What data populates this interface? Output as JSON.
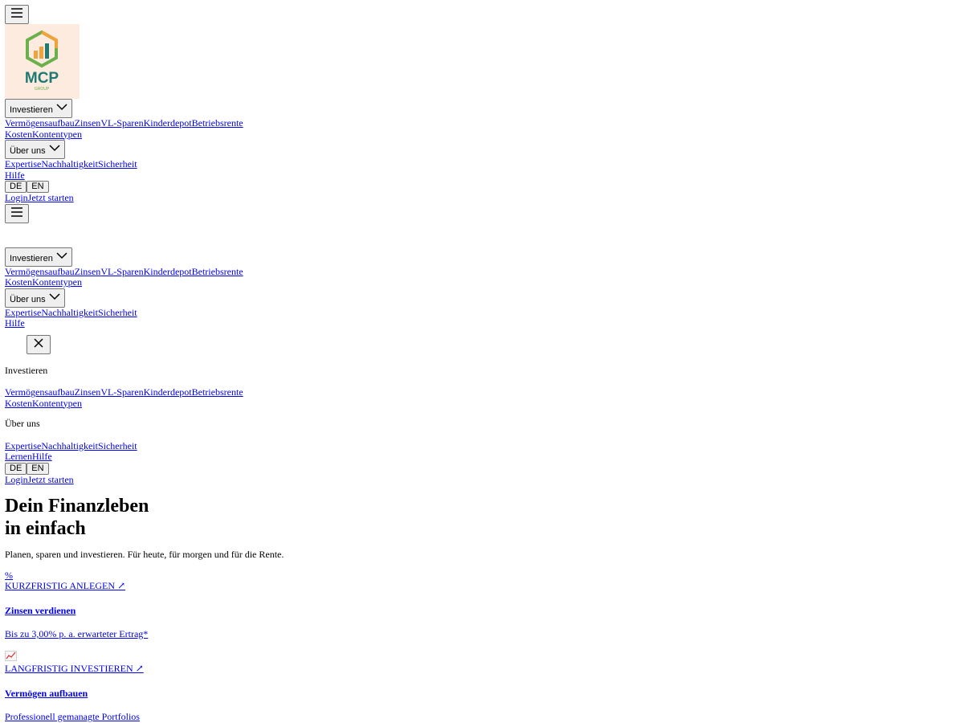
{
  "header": {
    "invest_label": "Investieren",
    "invest_links": [
      "Vermögensaufbau",
      "Zinsen",
      "VL-Sparen",
      "Kinderdepot",
      "Betriebsrente"
    ],
    "invest_links_2": [
      "Kosten",
      "Kontentypen"
    ],
    "about_label": "Über uns",
    "about_links": [
      "Expertise",
      "Nachhaltigkeit",
      "Sicherheit"
    ],
    "help_label": "Hilfe",
    "lang_de": "DE",
    "lang_en": "EN",
    "login_label": "Login",
    "start_label": "Jetzt starten"
  },
  "logo": {
    "text": "MCP",
    "subtext": "GROUP"
  },
  "mobile_menu": {
    "invest_heading": "Investieren",
    "about_heading": "Über uns",
    "learn_label": "Lernen",
    "help_label": "Hilfe"
  },
  "hero": {
    "title_line1": "Dein Finanzleben",
    "title_line2": "in einfach",
    "subtitle": "Planen, sparen und investieren. Für heute, für morgen und für die Rente."
  },
  "cards": [
    {
      "icon_text": "%",
      "kicker": "KURZFRISTIG ANLEGEN ↗",
      "title": "Zinsen verdienen",
      "desc": "Bis zu 3,00% p. a. erwarteter Ertrag*"
    },
    {
      "icon_text": "",
      "icon": "chart-increasing-icon",
      "kicker": "LANGFRISTIG INVESTIEREN ↗",
      "title": "Vermögen aufbauen",
      "desc": "Professionell gemanagte Portfolios"
    }
  ],
  "colors": {
    "link": "#0000ee",
    "logo_bg": "#fdebdf",
    "logo_teal": "#1f7a73",
    "logo_orange": "#f0a33a",
    "logo_green": "#6bb04a"
  }
}
